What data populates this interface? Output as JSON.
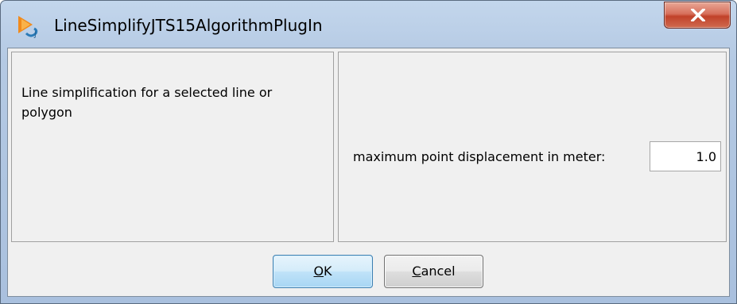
{
  "window": {
    "title": "LineSimplifyJTS15AlgorithmPlugIn",
    "app_icon": "jump-plugin-icon",
    "close_icon": "close-icon",
    "accent": "#c1422a"
  },
  "description": {
    "text": "Line simplification for a selected line or polygon"
  },
  "parameters": [
    {
      "label": "maximum point displacement in meter:",
      "value": "1.0"
    }
  ],
  "buttons": {
    "ok": {
      "mnemonic": "O",
      "rest": "K"
    },
    "cancel": {
      "mnemonic": "C",
      "rest": "ancel"
    }
  }
}
